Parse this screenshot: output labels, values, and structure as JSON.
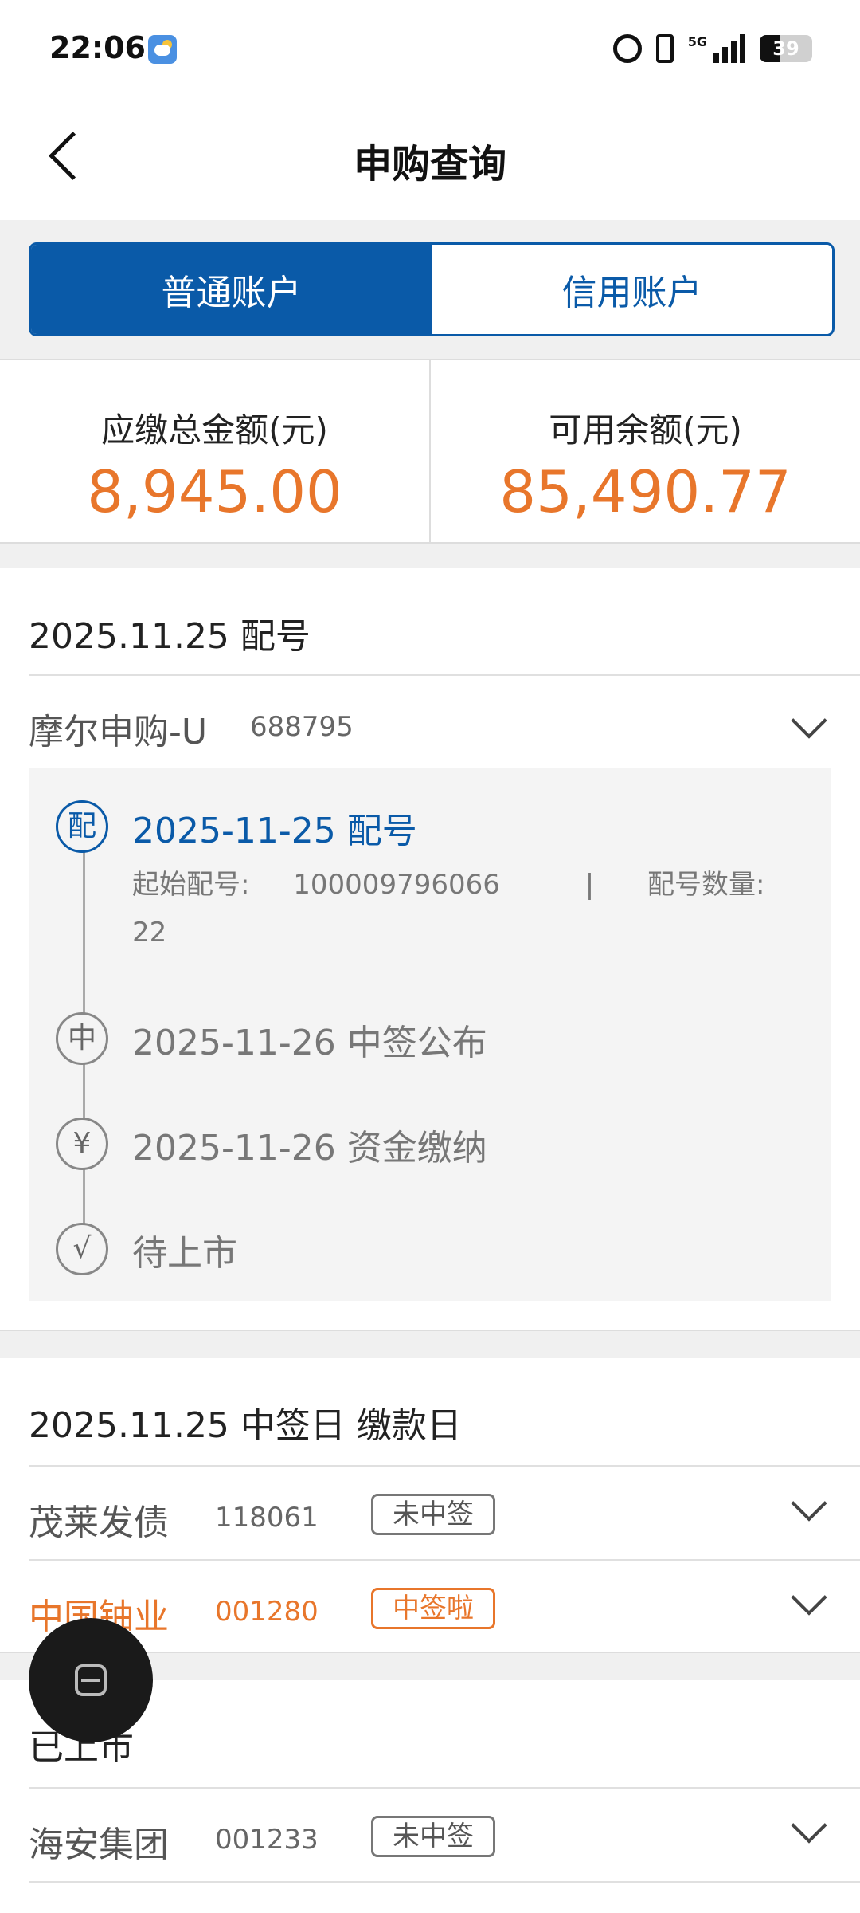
{
  "status": {
    "time": "22:06",
    "network": "5G",
    "battery": "39",
    "battery_level": 39
  },
  "nav": {
    "title": "申购查询"
  },
  "tabs": [
    {
      "label": "普通账户",
      "active": true
    },
    {
      "label": "信用账户",
      "active": false
    }
  ],
  "summary": {
    "due": {
      "label": "应缴总金额(元)",
      "value": "8,945.00"
    },
    "available": {
      "label": "可用余额(元)",
      "value": "85,490.77"
    }
  },
  "section1": {
    "title": "2025.11.25 配号",
    "stock": {
      "name": "摩尔申购-U",
      "code": "688795"
    },
    "timeline": [
      {
        "icon": "配",
        "title": "2025-11-25 配号",
        "active": true
      },
      {
        "icon": "中",
        "title": "2025-11-26 中签公布",
        "active": false
      },
      {
        "icon": "¥",
        "title": "2025-11-26 资金缴纳",
        "active": false
      },
      {
        "icon": "√",
        "title": "待上市",
        "active": false
      }
    ],
    "detail": {
      "start_label": "起始配号:",
      "start_value": "100009796066",
      "separator": "|",
      "count_label": "配号数量:",
      "count_value": "22"
    }
  },
  "section2": {
    "title": "2025.11.25 中签日 缴款日",
    "stocks": [
      {
        "name": "茂莱发债",
        "code": "118061",
        "status": "未中签",
        "win": false
      },
      {
        "name": "中国铀业",
        "code": "001280",
        "status": "中签啦",
        "win": true
      }
    ]
  },
  "section3": {
    "title": "已上市",
    "stocks": [
      {
        "name": "海安集团",
        "code": "001233",
        "status": "未中签",
        "win": false
      }
    ]
  },
  "colors": {
    "accent_blue": "#0a5aa8",
    "accent_orange": "#e8762b"
  }
}
